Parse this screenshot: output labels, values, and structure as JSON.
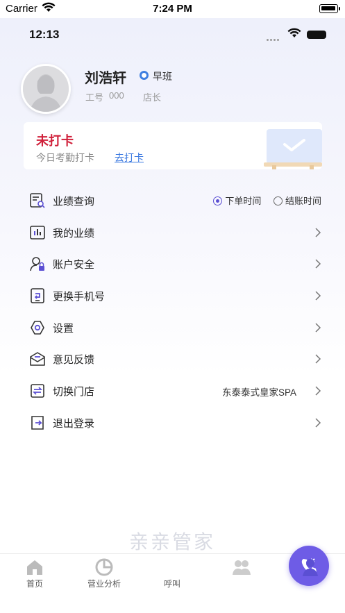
{
  "outer_status": {
    "carrier": "Carrier",
    "time": "7:24 PM"
  },
  "inner_status": {
    "time": "12:13"
  },
  "profile": {
    "name": "刘浩轩",
    "shift": "早班",
    "job_no_label": "工号",
    "job_no_value": "000",
    "role": "店长"
  },
  "clock_card": {
    "status": "未打卡",
    "subtitle": "今日考勤打卡",
    "action": "去打卡",
    "status_color": "#d0203a",
    "link_color": "#3a78e0"
  },
  "menu": {
    "performance_query": {
      "label": "业绩查询",
      "options": [
        "下单时间",
        "结账时间"
      ],
      "selected": "下单时间"
    },
    "items": [
      {
        "label": "我的业绩",
        "icon": "bar-chart-icon"
      },
      {
        "label": "账户安全",
        "icon": "user-lock-icon"
      },
      {
        "label": "更换手机号",
        "icon": "phone-swap-icon"
      },
      {
        "label": "设置",
        "icon": "gear-icon"
      },
      {
        "label": "意见反馈",
        "icon": "feedback-mail-icon"
      },
      {
        "label": "切换门店",
        "icon": "switch-store-icon",
        "value": "东泰泰式皇家SPA"
      },
      {
        "label": "退出登录",
        "icon": "logout-icon"
      }
    ]
  },
  "watermark": "亲亲管家",
  "tabbar": {
    "tabs": [
      {
        "label": "首页",
        "icon": "home-icon"
      },
      {
        "label": "营业分析",
        "icon": "pie-chart-icon"
      },
      {
        "label": "呼叫",
        "icon": "phone-call-icon"
      },
      {
        "label": "",
        "icon": "people-icon"
      },
      {
        "label": "",
        "icon": "person-icon"
      }
    ]
  },
  "colors": {
    "accent": "#5b4fd3",
    "call_button": "#6e5ce6"
  }
}
